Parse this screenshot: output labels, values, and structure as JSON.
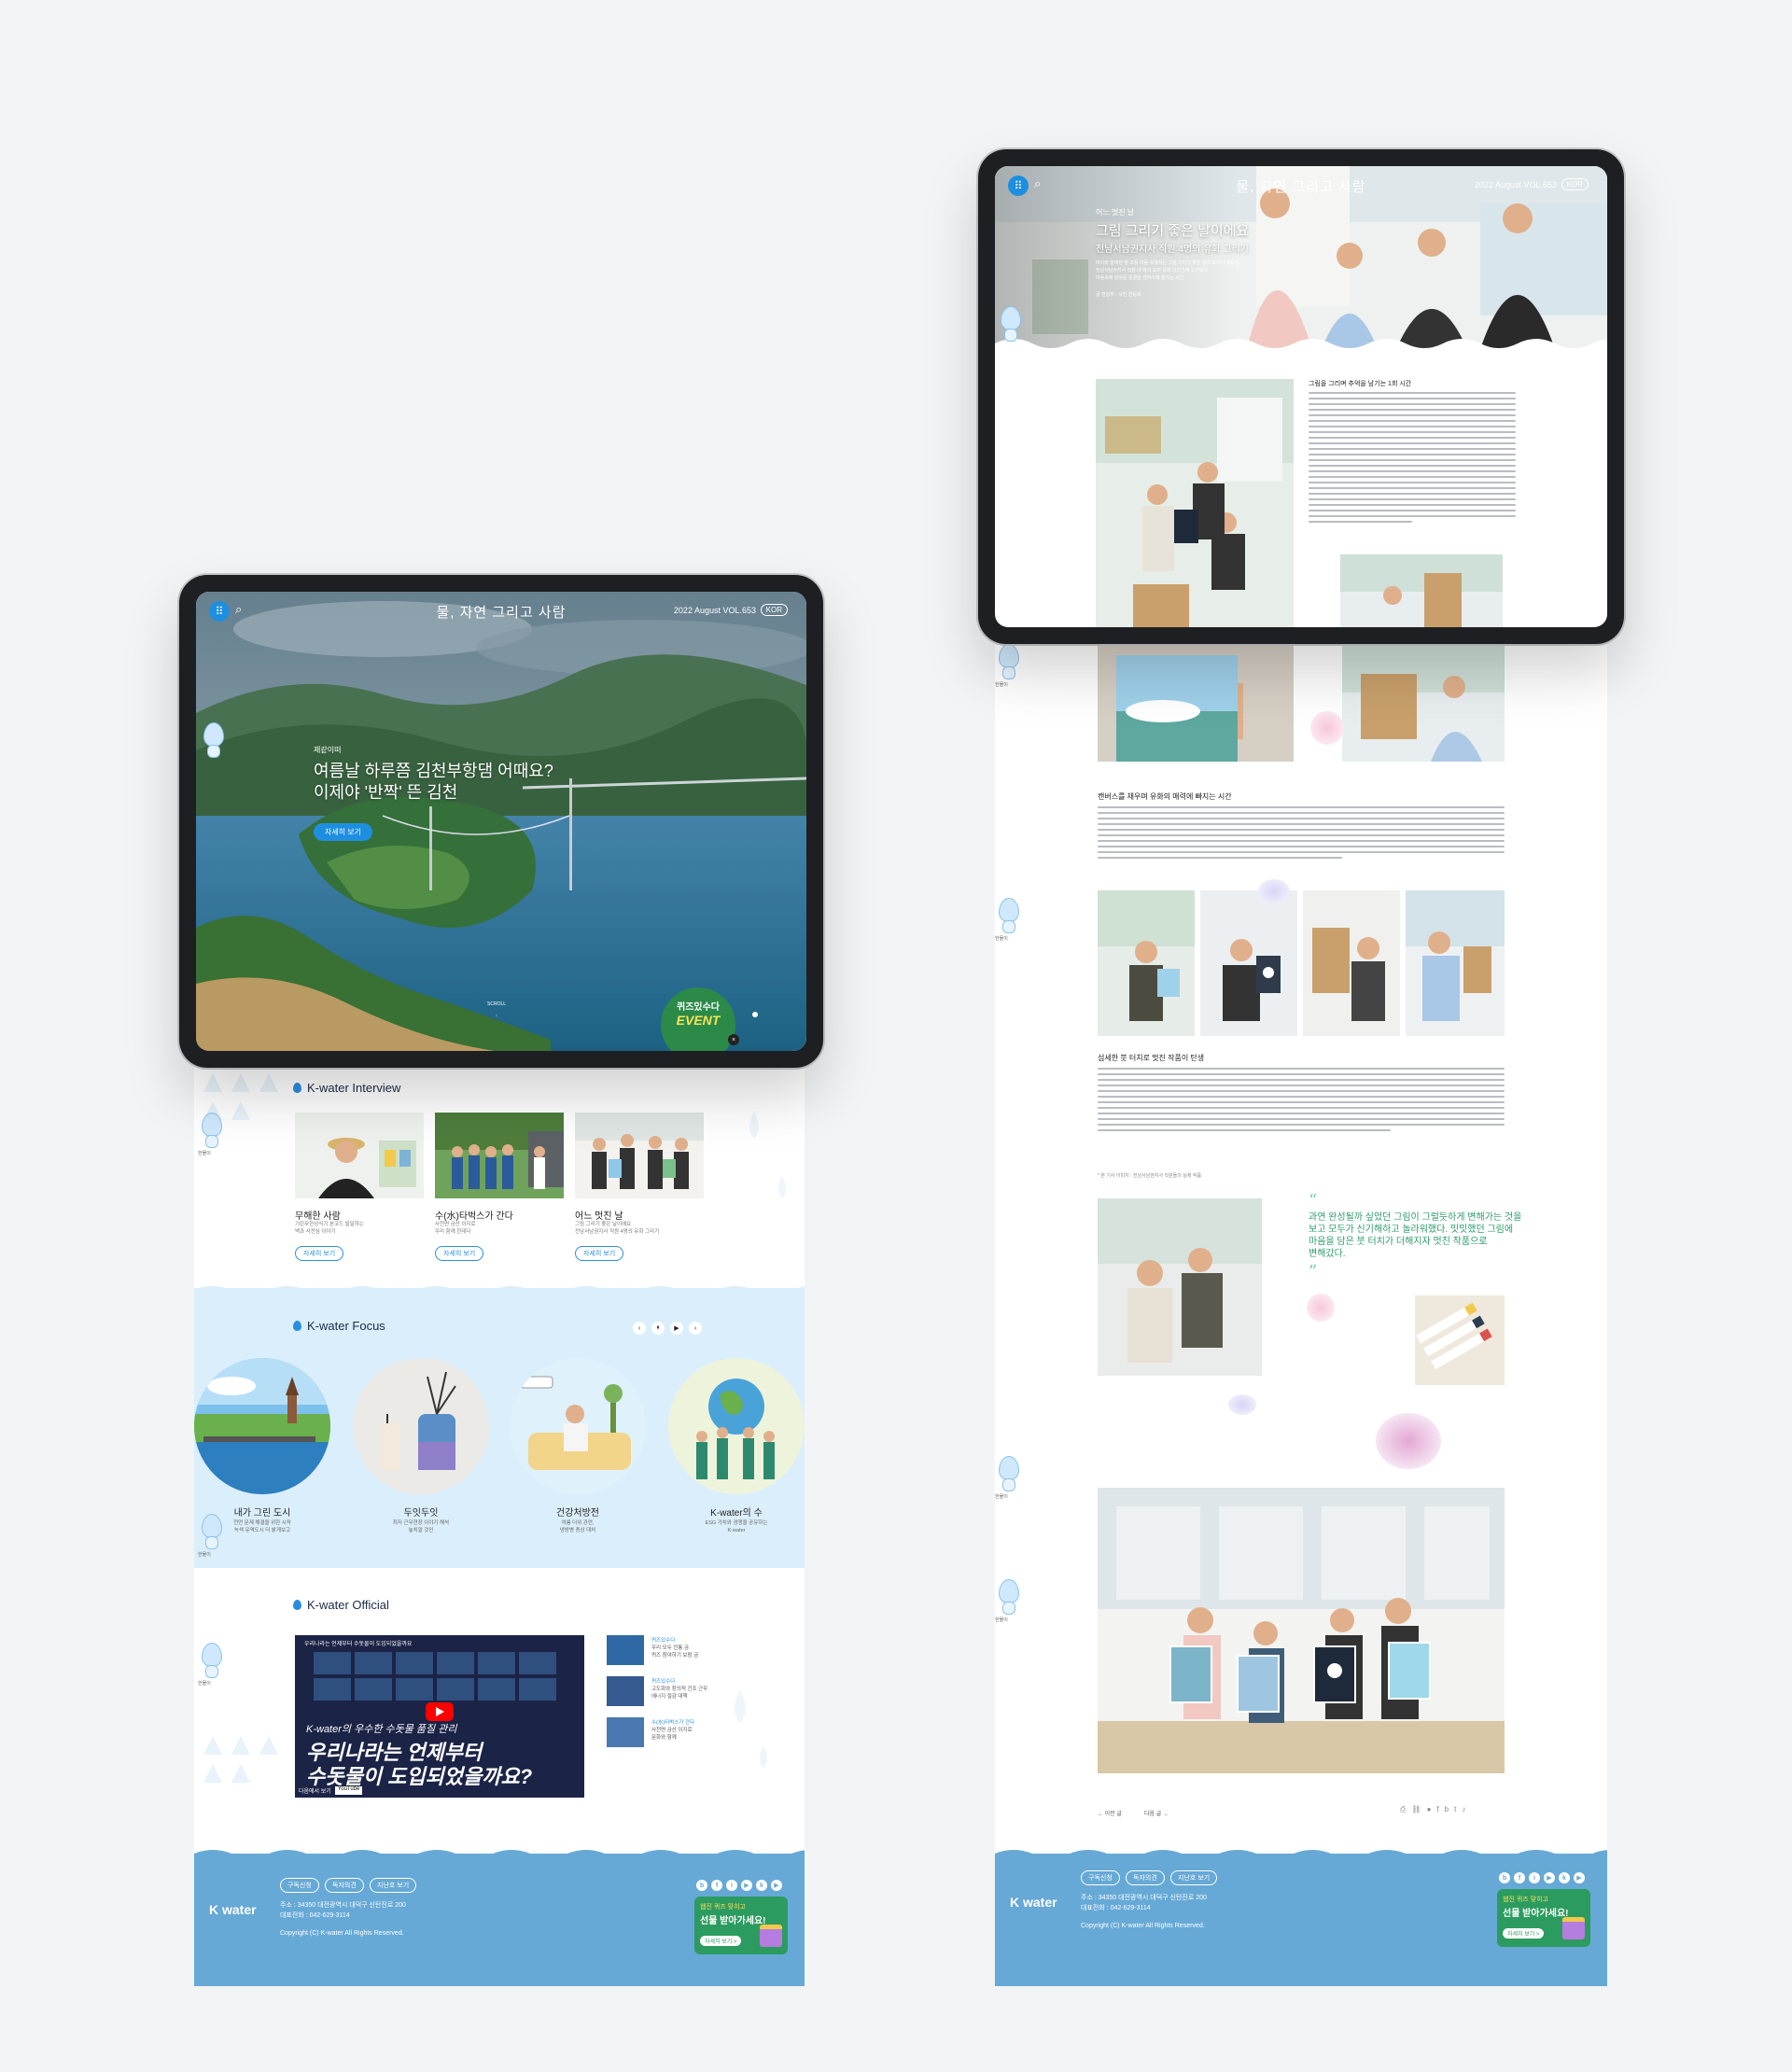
{
  "app_title": "물, 자연 그리고 사람",
  "issue": "2022 August VOL.653",
  "lang": "KOR",
  "home": {
    "hero": {
      "category": "제같이떠",
      "headline_1": "여름날 하루쯤 김천부항댐 어때요?",
      "headline_2": "이제야 '반짝' 뜬 김천",
      "cta": "자세히 보기",
      "scroll": "SCROLL",
      "event_1": "퀴즈있수다",
      "event_2": "EVENT"
    },
    "interview": {
      "title": "K-water Interview",
      "cards": [
        {
          "title": "무해한 사람",
          "desc_1": "기린무한상식기 본코드 발달하는",
          "desc_2": "백과 사전심 이야기",
          "more": "자세히 보기"
        },
        {
          "title": "수(水)타벅스가 간다",
          "desc_1": "사천면 금산 이지로",
          "desc_2": "우리 함께 한데다",
          "more": "자세히 보기"
        },
        {
          "title": "어느 멋진 날",
          "desc_1": "그림 그리기 좋은 날이에요",
          "desc_2": "전남서남권지사 직원 4명의 유화 그리기",
          "more": "자세히 보기"
        }
      ]
    },
    "focus": {
      "title": "K-water Focus",
      "items": [
        {
          "title": "내가 그린 도시",
          "desc_1": "천연 문제 해결을 위한 시작",
          "desc_2": "녹색 유역도시 더 밝게보고"
        },
        {
          "title": "두잇두잇",
          "desc_1": "최저 근무현장 이야기 해석",
          "desc_2": "놓치말 것인"
        },
        {
          "title": "건강처방전",
          "desc_1": "여름 더위 관련,",
          "desc_2": "냉방병 증상 대처"
        },
        {
          "title": "K-water의 수",
          "desc_1": "ESG 가치와 경쟁을 공유하는",
          "desc_2": "K-water"
        }
      ]
    },
    "official": {
      "title": "K-water Official",
      "video_caption": "K-water의 우수한 수돗물 품질 관리",
      "video_head_1": "우리나라는 언제부터",
      "video_head_2": "수돗물이 도입되었을까요?",
      "video_top": "우리나라는 언제부터 수돗물이 도입되었을까요",
      "youtube": "YouTube",
      "watch": "다음에서 보기",
      "side": [
        {
          "tag": "퀴즈있수다",
          "line_1": "우리 모두 전통 금",
          "line_2": "퀴즈 참여하기 보람 금"
        },
        {
          "tag": "퀴즈있수다",
          "line_1": "고도화와 창의적 건조 근무",
          "line_2": "에너지 절감 대책"
        },
        {
          "tag": "수(水)타벅스가 간다",
          "line_1": "사천면 금산 이지로",
          "line_2": "문화와 함께"
        }
      ]
    }
  },
  "article": {
    "category": "어느 멋진 날",
    "headline": "그림 그리기 좋은 날이에요",
    "sub": "전남서남권지사 직원 4명의 유화 그리기",
    "intro_1": "바다와 함께한 잠 조용 마음 속에서는 그림 그리기 좋은 일이 오가기 때문에",
    "intro_2": "전남서남권지사 직원 네 명이 모여 유화 그리기에 도전했다",
    "intro_3": "마음속에 담아둔 풍경을 캔버스에 옮기는 시간",
    "byline": "글 편집부 · 사진 한승희",
    "h1": "그림을 그리며 추억을 남기는 1회 시간",
    "h2": "캔버스를 채우며 유화의 매력에 빠지는 시간",
    "h3": "섬세한 붓 터치로 멋진 작품이 탄생",
    "quote_1": "과연 완성될까 싶었던 그림이 그럴듯하게 변해가는 것을",
    "quote_2": "보고 모두가 신기해하고 놀라워했다. 밋밋했던 그림에",
    "quote_3": "마음을 담은 붓 터치가 더해지자 멋진 작품으로",
    "quote_4": "변해갔다.",
    "footnote": "* 본 기사 이미지 : 전남서남권지사 직원들의 실제 작품",
    "prev": "← 이전 글",
    "next": "다음 글 →"
  },
  "footer": {
    "logo": "K water",
    "pills": [
      "구독신청",
      "독자의견",
      "지난호 보기"
    ],
    "addr_1": "주소 : 34350 대전광역시 대덕구 신탄진로 200",
    "addr_2": "대표전화 : 042-629-3114",
    "copy": "Copyright (C) K-water All Rights Reserved.",
    "gift_1": "웹진 퀴즈 맞히고",
    "gift_2": "선물 받아가세요!",
    "gift_3": "자세히 보기 >",
    "social": [
      "b",
      "f",
      "i",
      "▶",
      "k",
      "▶"
    ]
  },
  "mascot_label": "한물이",
  "colors": {
    "accent": "#2a8ee0",
    "footer": "#66a9d6",
    "green": "#2c9b5f"
  }
}
